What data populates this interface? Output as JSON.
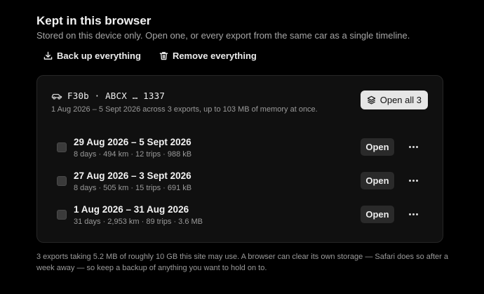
{
  "header": {
    "title": "Kept in this browser",
    "subtitle": "Stored on this device only. Open one, or every export from the same car as a single timeline."
  },
  "actions": {
    "backup_label": "Back up everything",
    "remove_label": "Remove everything"
  },
  "car": {
    "name": "F30b · ABCX … 1337",
    "meta": "1 Aug 2026 – 5 Sept 2026 across 3 exports, up to 103 MB of memory at once.",
    "open_all_label": "Open all 3"
  },
  "exports": [
    {
      "title": "29 Aug 2026 – 5 Sept 2026",
      "meta": "8 days · 494 km · 12 trips · 988 kB",
      "open_label": "Open"
    },
    {
      "title": "27 Aug 2026 – 3 Sept 2026",
      "meta": "8 days · 505 km · 15 trips · 691 kB",
      "open_label": "Open"
    },
    {
      "title": "1 Aug 2026 – 31 Aug 2026",
      "meta": "31 days · 2,953 km · 89 trips · 3.6 MB",
      "open_label": "Open"
    }
  ],
  "footer": {
    "text": "3 exports taking 5.2 MB of roughly 10 GB this site may use. A browser can clear its own storage — Safari does so after a week away — so keep a backup of anything you want to hold on to."
  },
  "colors": {
    "background": "#000000",
    "card": "#101010",
    "primary_button": "#e6e6e6",
    "secondary_button": "#2a2a2a"
  }
}
